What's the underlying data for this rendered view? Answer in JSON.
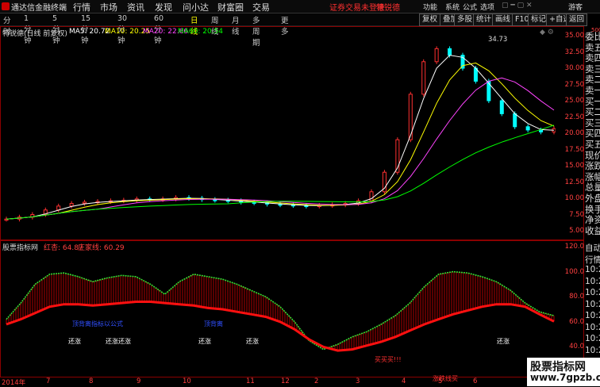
{
  "menu": {
    "app_title": "通达信金融终端",
    "items": [
      "行情",
      "市场",
      "资讯",
      "发现",
      "问小达",
      "财富圈",
      "交易"
    ],
    "warning": "证券交易未登录",
    "stock_tag": "特锐德",
    "right": [
      "功能",
      "系统",
      "公式",
      "选项",
      "游客"
    ]
  },
  "periods": [
    "分时",
    "1分钟",
    "5分钟",
    "15分钟",
    "30分钟",
    "60分钟",
    "日线",
    "周线",
    "月线",
    "多周期",
    "更多"
  ],
  "active_period": "日线",
  "toolbar": [
    "复权",
    "叠加",
    "多股",
    "统计",
    "画线",
    "F10",
    "标记",
    "+自选",
    "返回"
  ],
  "main_legend": {
    "stock": "特锐德(日线 前复权)",
    "ma": [
      {
        "label": "MA5: 20.72",
        "color": "#ffffff"
      },
      {
        "label": "MA10: 20.25",
        "color": "#ffff00"
      },
      {
        "label": "MA20: 22.66",
        "color": "#ff44ff"
      },
      {
        "label": "MA60: 20.54",
        "color": "#00ff00"
      }
    ],
    "peak_label": "34.73"
  },
  "price_axis": [
    "35.00",
    "32.50",
    "30.00",
    "27.50",
    "25.00",
    "22.50",
    "20.00",
    "17.50",
    "15.00",
    "12.50",
    "10.00",
    "7.50",
    "5.00"
  ],
  "sub_legend": {
    "name": "股票指标网",
    "red_label": "红杏: 64.87",
    "line_label": "庄家线: 60.29"
  },
  "sub_axis": [
    "120.0",
    "100.0",
    "80.0",
    "60.0",
    "40.0",
    "20.0"
  ],
  "sub_annotations": {
    "blue_text": [
      "顶背离指标以公式",
      "顶背离"
    ],
    "white_text": [
      "还涨",
      "还涨还涨",
      "还涨",
      "还涨",
      "还涨"
    ],
    "red_text": [
      "买买买!!!",
      "涨跌线买"
    ]
  },
  "x_ticks": [
    "2014年",
    "7",
    "8",
    "9",
    "10",
    "11",
    "12",
    "2",
    "3",
    "4",
    "5",
    "6"
  ],
  "right_panel": {
    "rows": [
      "委比",
      "卖五",
      "卖四",
      "卖三",
      "卖二",
      "卖一",
      "买一",
      "买二",
      "买三",
      "买四",
      "买五",
      "现价",
      "涨跌",
      "涨幅",
      "总量",
      "外盘",
      "换手",
      "净资",
      "收益"
    ],
    "bottom": [
      "自动",
      "行情",
      "10:26",
      "10:26",
      "10:26",
      "10:26",
      "10:26",
      "10:26",
      "10:26",
      "10:26"
    ]
  },
  "watermark": {
    "line1": "股票指标网",
    "line2": "www.7gpzb.com"
  },
  "chart_data": {
    "type": "candlestick+indicator",
    "title": "特锐德(日线 前复权)",
    "main_ylim": [
      5,
      35
    ],
    "sub_ylim": [
      20,
      120
    ],
    "peak": 34.73,
    "close_series": [
      6.8,
      7.1,
      7.5,
      8.2,
      8.8,
      9.2,
      9.4,
      9.5,
      9.6,
      9.7,
      9.9,
      9.8,
      9.9,
      10.1,
      10.0,
      9.8,
      9.7,
      9.6,
      9.4,
      9.3,
      9.1,
      9.0,
      8.9,
      8.8,
      8.9,
      9.0,
      9.2,
      9.6,
      11,
      14,
      19,
      26,
      31,
      33,
      32,
      30,
      28,
      25,
      23,
      21,
      20.5,
      20.2,
      20.7
    ],
    "ma60_end": 20.54,
    "red_indicator": [
      62,
      75,
      90,
      98,
      99,
      96,
      92,
      95,
      97,
      96,
      90,
      82,
      92,
      98,
      96,
      94,
      90,
      85,
      80,
      72,
      60,
      45,
      38,
      42,
      48,
      52,
      58,
      65,
      75,
      88,
      98,
      100,
      99,
      96,
      92,
      85,
      75,
      68,
      64.87
    ],
    "zhuangjia_line": [
      58,
      62,
      67,
      72,
      74,
      74,
      73,
      74,
      75,
      76,
      76,
      75,
      74,
      73,
      71,
      70,
      68,
      66,
      64,
      60,
      54,
      46,
      40,
      37,
      38,
      41,
      44,
      48,
      53,
      58,
      62,
      66,
      69,
      72,
      74,
      74,
      72,
      66,
      60.29
    ]
  }
}
